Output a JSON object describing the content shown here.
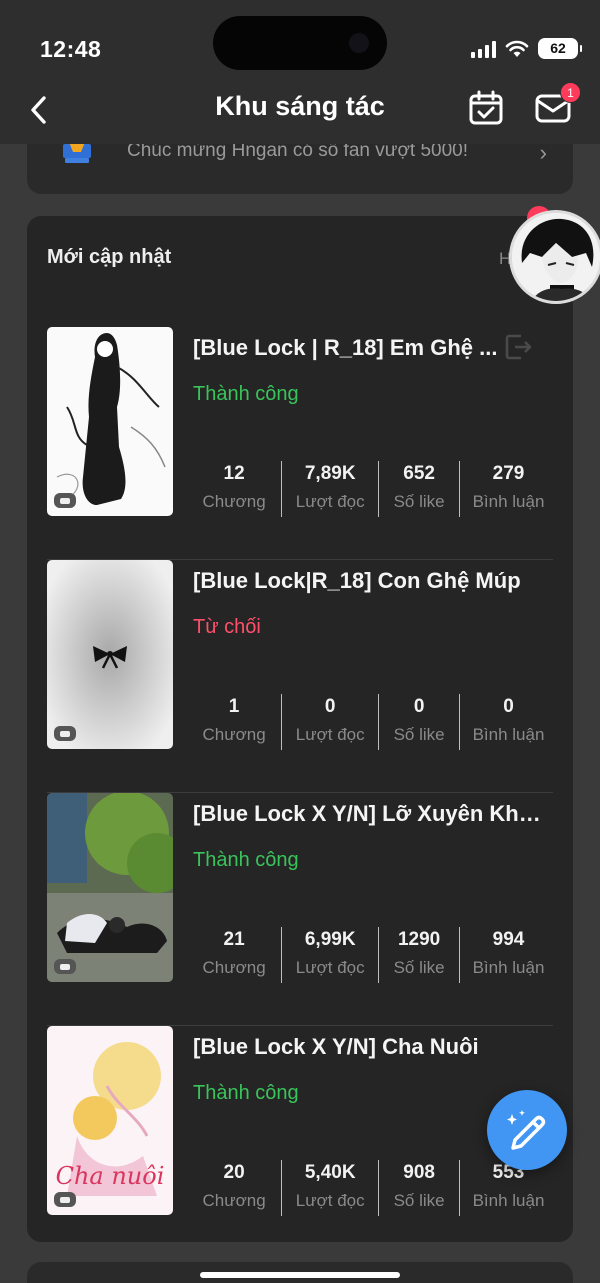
{
  "status_bar": {
    "time": "12:48",
    "battery": "62"
  },
  "nav": {
    "title": "Khu sáng tác",
    "mail_badge": "1"
  },
  "notice": {
    "text": "Chúc mừng Hngan  có số fan vượt 5000!",
    "chevron": "›"
  },
  "section": {
    "title": "Mới cập nhật",
    "more": "H"
  },
  "stat_labels": {
    "chapters": "Chương",
    "reads": "Lượt đọc",
    "likes": "Số like",
    "comments": "Bình luận"
  },
  "stories": [
    {
      "title": "[Blue Lock | R_18] Em Ghệ ...",
      "status": "Thành công",
      "status_type": "ok",
      "chapters": "12",
      "reads": "7,89K",
      "likes": "652",
      "comments": "279"
    },
    {
      "title": "[Blue Lock|R_18] Con Ghệ Múp",
      "status": "Từ chối",
      "status_type": "bad",
      "chapters": "1",
      "reads": "0",
      "likes": "0",
      "comments": "0"
    },
    {
      "title": "[Blue Lock X Y/N] Lỡ Xuyên Khô...",
      "status": "Thành công",
      "status_type": "ok",
      "chapters": "21",
      "reads": "6,99K",
      "likes": "1290",
      "comments": "994"
    },
    {
      "title": "[Blue Lock X Y/N] Cha Nuôi",
      "status": "Thành công",
      "status_type": "ok",
      "chapters": "20",
      "reads": "5,40K",
      "likes": "908",
      "comments": "553",
      "cover_text": "Cha nuôi"
    }
  ],
  "colors": {
    "success": "#39c45a",
    "rejected": "#ff4f6b",
    "fab": "#4096f2"
  }
}
